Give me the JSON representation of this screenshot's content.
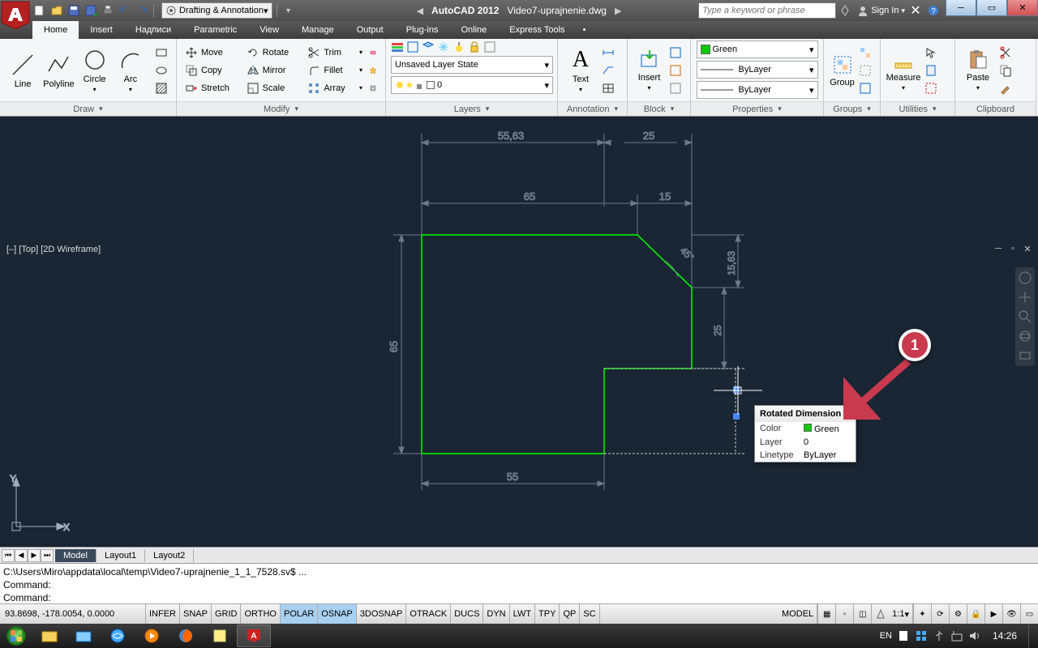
{
  "title": {
    "app": "AutoCAD 2012",
    "file": "Video7-uprajnenie.dwg"
  },
  "workspace": "Drafting & Annotation",
  "search_placeholder": "Type a keyword or phrase",
  "signin": "Sign In",
  "tabs": [
    "Home",
    "Insert",
    "Надписи",
    "Parametric",
    "View",
    "Manage",
    "Output",
    "Plug-ins",
    "Online",
    "Express Tools"
  ],
  "active_tab": 0,
  "panels": {
    "draw": {
      "title": "Draw",
      "items": [
        "Line",
        "Polyline",
        "Circle",
        "Arc"
      ]
    },
    "modify": {
      "title": "Modify",
      "rows": [
        [
          "Move",
          "Rotate",
          "Trim"
        ],
        [
          "Copy",
          "Mirror",
          "Fillet"
        ],
        [
          "Stretch",
          "Scale",
          "Array"
        ]
      ]
    },
    "layers": {
      "title": "Layers",
      "state": "Unsaved Layer State",
      "current": "0"
    },
    "annotation": {
      "title": "Annotation",
      "text_label": "Text"
    },
    "block": {
      "title": "Block",
      "insert_label": "Insert"
    },
    "properties": {
      "title": "Properties",
      "color": "Green",
      "linetype": "ByLayer",
      "lineweight": "ByLayer"
    },
    "groups": {
      "title": "Groups",
      "group_label": "Group"
    },
    "utilities": {
      "title": "Utilities",
      "measure_label": "Measure"
    },
    "clipboard": {
      "title": "Clipboard",
      "paste_label": "Paste"
    }
  },
  "viewport_label": "[–] [Top] [2D Wireframe]",
  "dimensions": {
    "d1": "55,63",
    "d2": "25",
    "d3": "65",
    "d4": "15",
    "d5": "65",
    "d6": "55",
    "d7": "15,63",
    "d8": "25",
    "d9": "45°"
  },
  "tooltip": {
    "title": "Rotated Dimension",
    "color_label": "Color",
    "color_value": "Green",
    "layer_label": "Layer",
    "layer_value": "0",
    "linetype_label": "Linetype",
    "linetype_value": "ByLayer"
  },
  "callout_num": "1",
  "sheet_tabs": [
    "Model",
    "Layout1",
    "Layout2"
  ],
  "active_sheet": 0,
  "cmd": {
    "line1": "C:\\Users\\Miro\\appdata\\local\\temp\\Video7-uprajnenie_1_1_7528.sv$ ...",
    "line2": "Command:",
    "line3": "",
    "line4": "Command:"
  },
  "coords": "93.8698, -178.0054, 0.0000",
  "status_toggles": [
    "INFER",
    "SNAP",
    "GRID",
    "ORTHO",
    "POLAR",
    "OSNAP",
    "3DOSNAP",
    "OTRACK",
    "DUCS",
    "DYN",
    "LWT",
    "TPY",
    "QP",
    "SC"
  ],
  "status_on": [
    "POLAR",
    "OSNAP"
  ],
  "status_right": {
    "model": "MODEL",
    "scale": "1:1"
  },
  "tray": {
    "lang": "EN",
    "time": "14:26"
  }
}
